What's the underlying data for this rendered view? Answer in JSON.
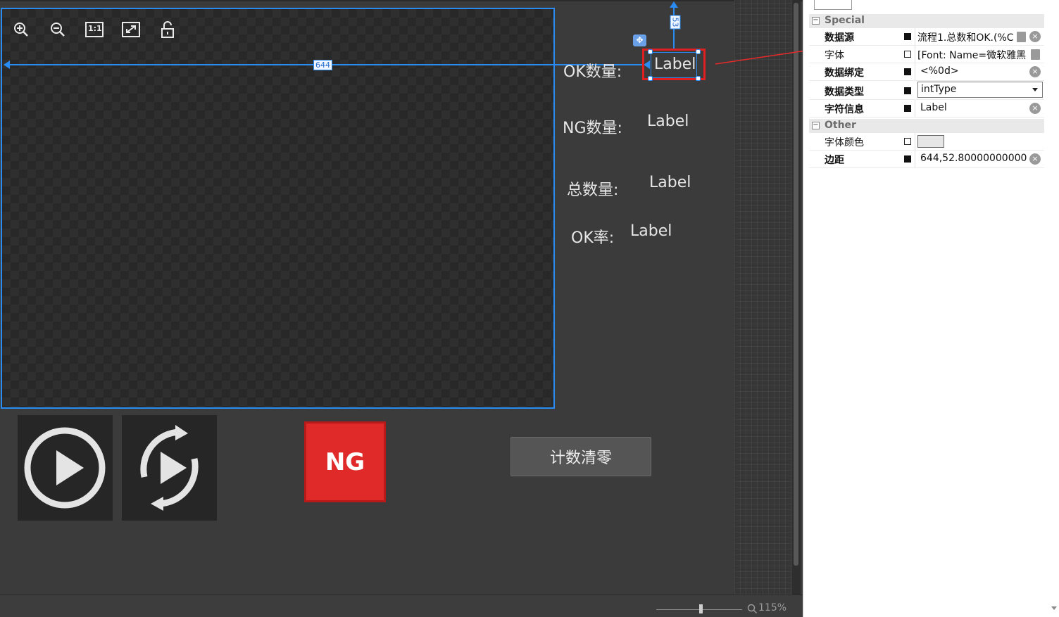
{
  "canvas": {
    "toolbar": [
      "zoom-in",
      "zoom-out",
      "actual-size",
      "fit-window",
      "unlock"
    ],
    "actual_size_label": "1:1",
    "guides": {
      "horizontal_distance": "644",
      "vertical_distance": "53"
    },
    "stats": {
      "ok_count_label": "OK数量:",
      "ok_count_value": "Label",
      "ng_count_label": "NG数量:",
      "ng_count_value": "Label",
      "total_label": "总数量:",
      "total_value": "Label",
      "ok_rate_label": "OK率:",
      "ok_rate_value": "Label"
    },
    "ng_indicator": "NG",
    "reset_button": "计数清零",
    "zoom_level": "115%"
  },
  "properties": {
    "categories": {
      "special": "Special",
      "other": "Other"
    },
    "rows": {
      "data_source": {
        "name": "数据源",
        "value": "流程1.总数和OK.(%C"
      },
      "font": {
        "name": "字体",
        "value": "[Font: Name=微软雅黑"
      },
      "data_binding": {
        "name": "数据绑定",
        "value": "<%0d>"
      },
      "data_type": {
        "name": "数据类型",
        "value": "intType"
      },
      "char_info": {
        "name": "字符信息",
        "value": "Label"
      },
      "font_color": {
        "name": "字体颜色",
        "value": ""
      },
      "margin": {
        "name": "边距",
        "value": "644,52.80000000000("
      }
    }
  },
  "colors": {
    "selection": "#e02020",
    "guide": "#2a8bf2",
    "ng": "#e02a2a",
    "canvas_bg": "#3b3b3b"
  }
}
